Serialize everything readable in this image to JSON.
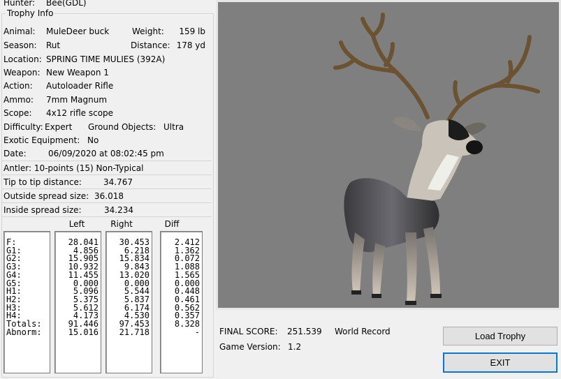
{
  "hunter": {
    "label": "Hunter:",
    "value": "Bee(GDL)"
  },
  "trophy_info": {
    "title": "Trophy Info",
    "animal": {
      "label": "Animal:",
      "value": "MuleDeer buck"
    },
    "weight": {
      "label": "Weight:",
      "value": "159 lb"
    },
    "season": {
      "label": "Season:",
      "value": "Rut"
    },
    "distance": {
      "label": "Distance:",
      "value": "178 yd"
    },
    "location": {
      "label": "Location:",
      "value": "SPRING TIME MULIES (392A)"
    },
    "weapon": {
      "label": "Weapon:",
      "value": "New Weapon 1"
    },
    "action": {
      "label": "Action:",
      "value": "Autoloader Rifle"
    },
    "ammo": {
      "label": "Ammo:",
      "value": "7mm Magnum"
    },
    "scope": {
      "label": "Scope:",
      "value": "4x12 rifle scope"
    },
    "difficulty": {
      "label": "Difficulty:",
      "value": "Expert"
    },
    "ground_objects": {
      "label": "Ground Objects:",
      "value": "Ultra"
    },
    "exotic": {
      "label": "Exotic Equipment:",
      "value": "No"
    },
    "date": {
      "label": "Date:",
      "value": "06/09/2020 at 08:02:45 pm"
    }
  },
  "antler": {
    "points": "Antler: 10-points (15) Non-Typical",
    "tip_to_tip": {
      "label": "Tip to tip distance:",
      "value": "34.767"
    },
    "outside_spread": {
      "label": "Outside spread size:",
      "value": "36.018"
    },
    "inside_spread": {
      "label": "Inside spread size:",
      "value": "34.234"
    }
  },
  "measurements": {
    "headers": {
      "left": "Left",
      "right": "Right",
      "diff": "Diff"
    },
    "labels": [
      "F:",
      "G1:",
      "G2:",
      "G3:",
      "G4:",
      "G5:",
      "H1:",
      "H2:",
      "H3:",
      "H4:",
      "Totals:",
      "Abnorm:"
    ],
    "left": [
      "28.041",
      "4.856",
      "15.905",
      "10.932",
      "11.455",
      "0.000",
      "5.096",
      "5.375",
      "5.612",
      "4.173",
      "91.446",
      "15.016"
    ],
    "right": [
      "30.453",
      "6.218",
      "15.834",
      "9.843",
      "13.020",
      "0.000",
      "5.544",
      "5.837",
      "6.174",
      "4.530",
      "97.453",
      "21.718"
    ],
    "diff": [
      "2.412",
      "1.362",
      "0.072",
      "1.088",
      "1.565",
      "0.000",
      "0.448",
      "0.461",
      "0.562",
      "0.357",
      "8.328",
      "-"
    ]
  },
  "score": {
    "final_label": "FINAL SCORE:",
    "final_value": "251.539",
    "record": "World Record",
    "version_label": "Game Version:",
    "version_value": "1.2"
  },
  "buttons": {
    "load": "Load Trophy",
    "exit": "EXIT"
  },
  "viewer": {
    "background": "#7f7f7f",
    "subject": "3D mule deer buck model"
  }
}
